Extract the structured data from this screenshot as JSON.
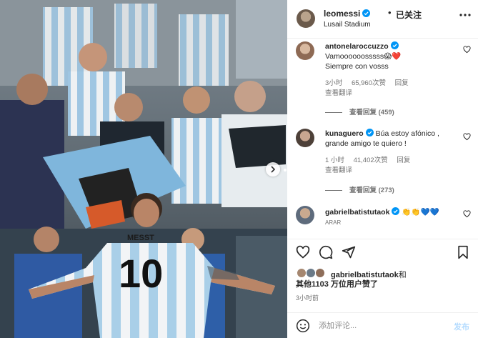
{
  "post": {
    "author": {
      "username": "leomessi",
      "separator": "•",
      "follow_label": "已关注",
      "location": "Lusail Stadium"
    },
    "photo": {
      "jersey_name": "MESST",
      "jersey_number": "10"
    },
    "comments": [
      {
        "username": "antonelaroccuzzo",
        "text_line1": "Vamoooooosssss😱❤️",
        "text_line2": "Siempre con vosss",
        "time": "3小时",
        "likes": "65,960次赞",
        "reply_label": "回复",
        "translate_label": "查看翻译",
        "view_replies": "查看回复 (459)"
      },
      {
        "username": "kunaguero",
        "text_line1": "Búa estoy afónico ,",
        "text_line2": "grande amigo te quiero !",
        "time": "1 小时",
        "likes": "41,402次赞",
        "reply_label": "回复",
        "translate_label": "查看翻译",
        "view_replies": "查看回复 (273)"
      },
      {
        "username": "gabrielbatistutaok",
        "text_line1": "👏👏💙💙",
        "sub": "ARAR"
      }
    ],
    "likes": {
      "liked_by": "gabrielbatistutaok",
      "suffix": "和",
      "line2": "其他1103 万位用户赞了"
    },
    "time_ago": "3小时前",
    "add_comment": {
      "placeholder": "添加评论...",
      "post_label": "发布"
    }
  },
  "colors": {
    "verified": "#0095f6",
    "text": "#262626",
    "secondary": "#737373",
    "post_button_disabled": "#b3dbff"
  },
  "icons": [
    "more-icon",
    "verified-icon",
    "heart-icon",
    "comment-icon",
    "share-icon",
    "bookmark-icon",
    "emoji-icon",
    "next-arrow-icon"
  ]
}
